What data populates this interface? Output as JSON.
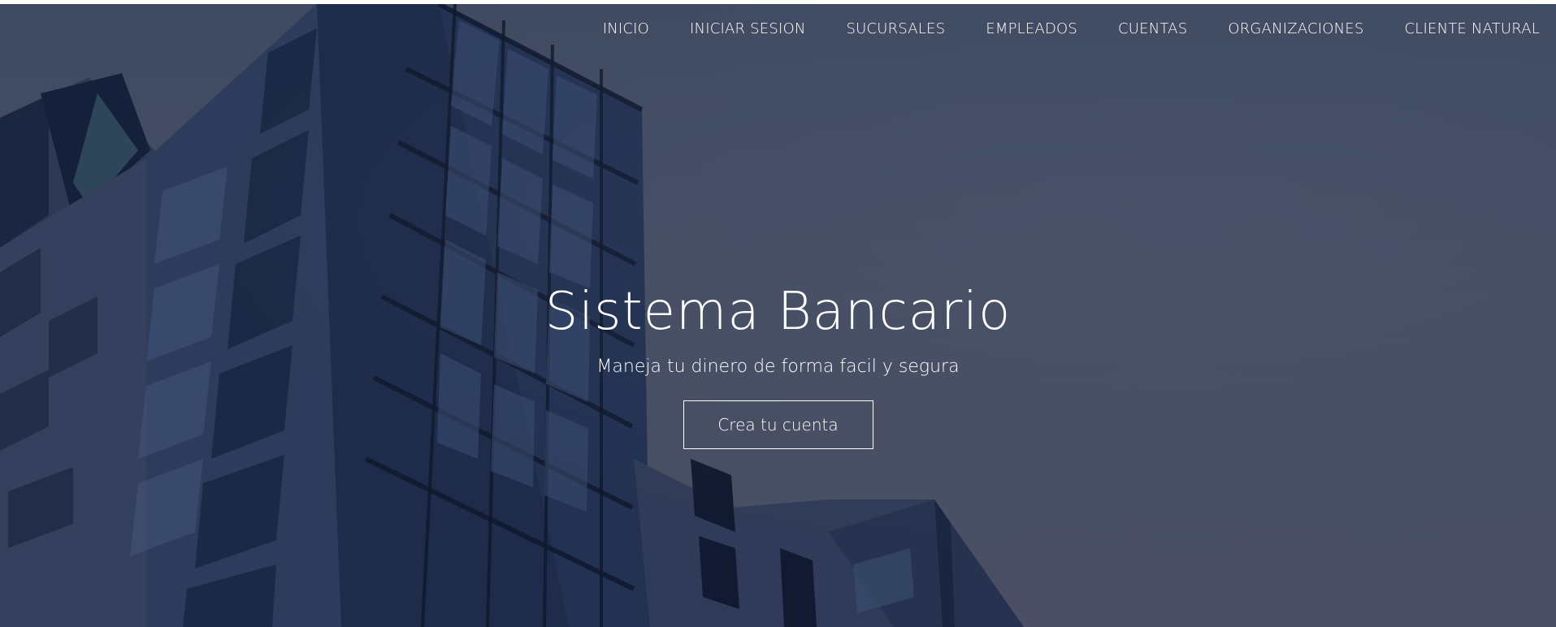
{
  "nav": {
    "items": [
      {
        "label": "INICIO"
      },
      {
        "label": "INICIAR SESION"
      },
      {
        "label": "SUCURSALES"
      },
      {
        "label": "EMPLEADOS"
      },
      {
        "label": "CUENTAS"
      },
      {
        "label": "ORGANIZACIONES"
      },
      {
        "label": "CLIENTE NATURAL"
      }
    ]
  },
  "hero": {
    "title": "Sistema Bancario",
    "subtitle": "Maneja tu dinero de forma facil y segura",
    "cta_label": "Crea tu cuenta"
  },
  "colors": {
    "overlay": "#424b62",
    "building_dark": "#1b2a45",
    "building_mid": "#2c3c5c",
    "text": "#ffffff"
  }
}
